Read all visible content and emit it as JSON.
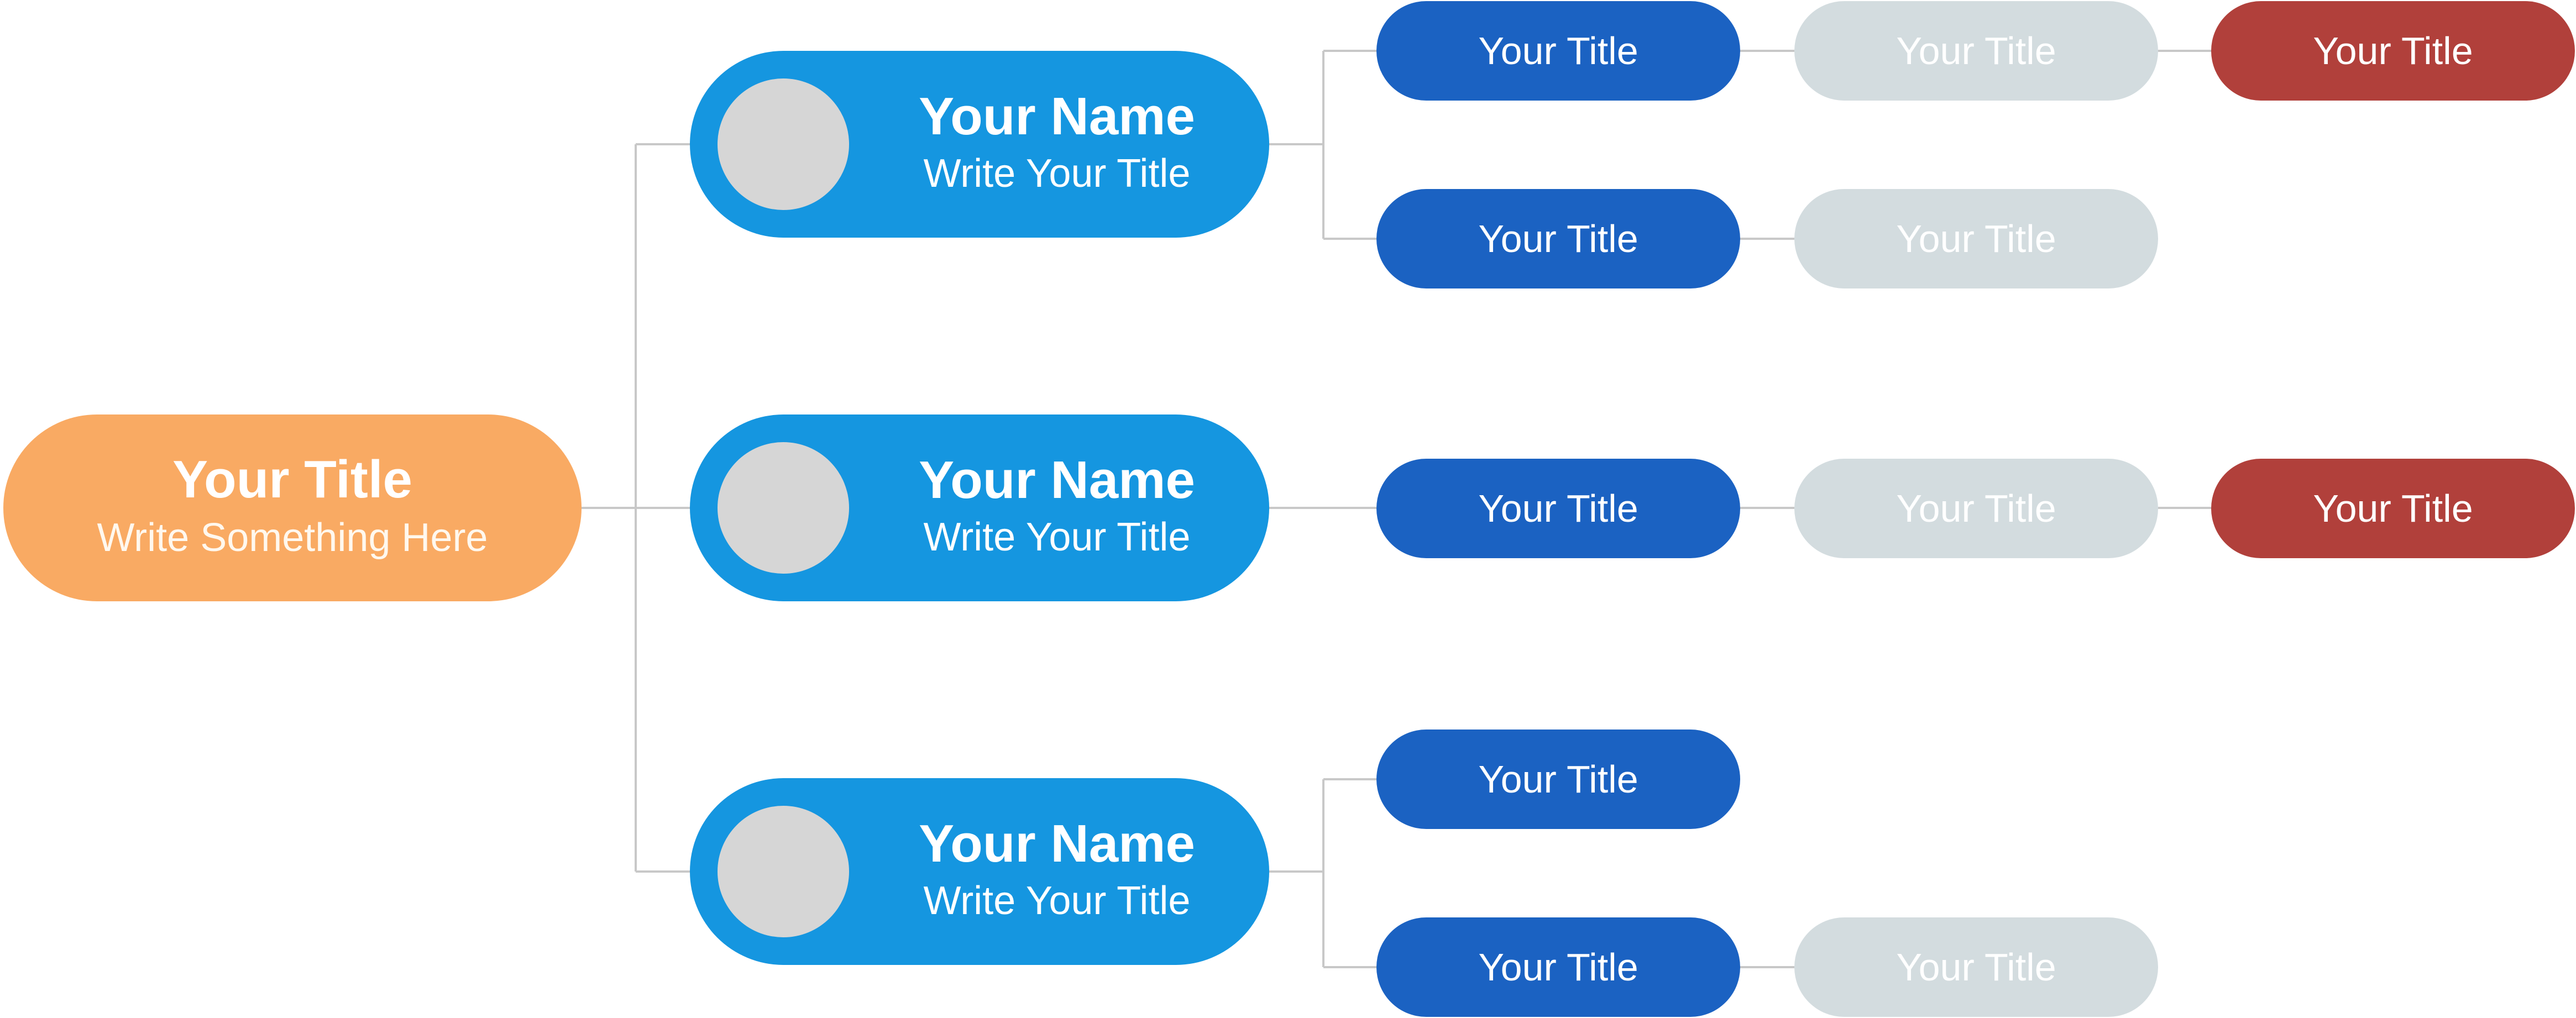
{
  "colors": {
    "root": "#f9aa63",
    "person": "#1596e0",
    "avatar": "#d6d6d6",
    "level2": "#1b62c2",
    "level3": "#d3dcdf",
    "level4": "#b1403b",
    "connector": "#c8c8c8"
  },
  "root": {
    "title": "Your Title",
    "subtitle": "Write Something Here"
  },
  "branches": [
    {
      "name": "Your Name",
      "role": "Write Your Title",
      "rows": [
        [
          "Your Title",
          "Your Title",
          "Your Title"
        ],
        [
          "Your Title",
          "Your Title"
        ]
      ]
    },
    {
      "name": "Your Name",
      "role": "Write Your Title",
      "rows": [
        [
          "Your Title",
          "Your Title",
          "Your Title"
        ]
      ]
    },
    {
      "name": "Your Name",
      "role": "Write Your Title",
      "rows": [
        [
          "Your Title"
        ],
        [
          "Your Title",
          "Your Title"
        ]
      ]
    }
  ]
}
